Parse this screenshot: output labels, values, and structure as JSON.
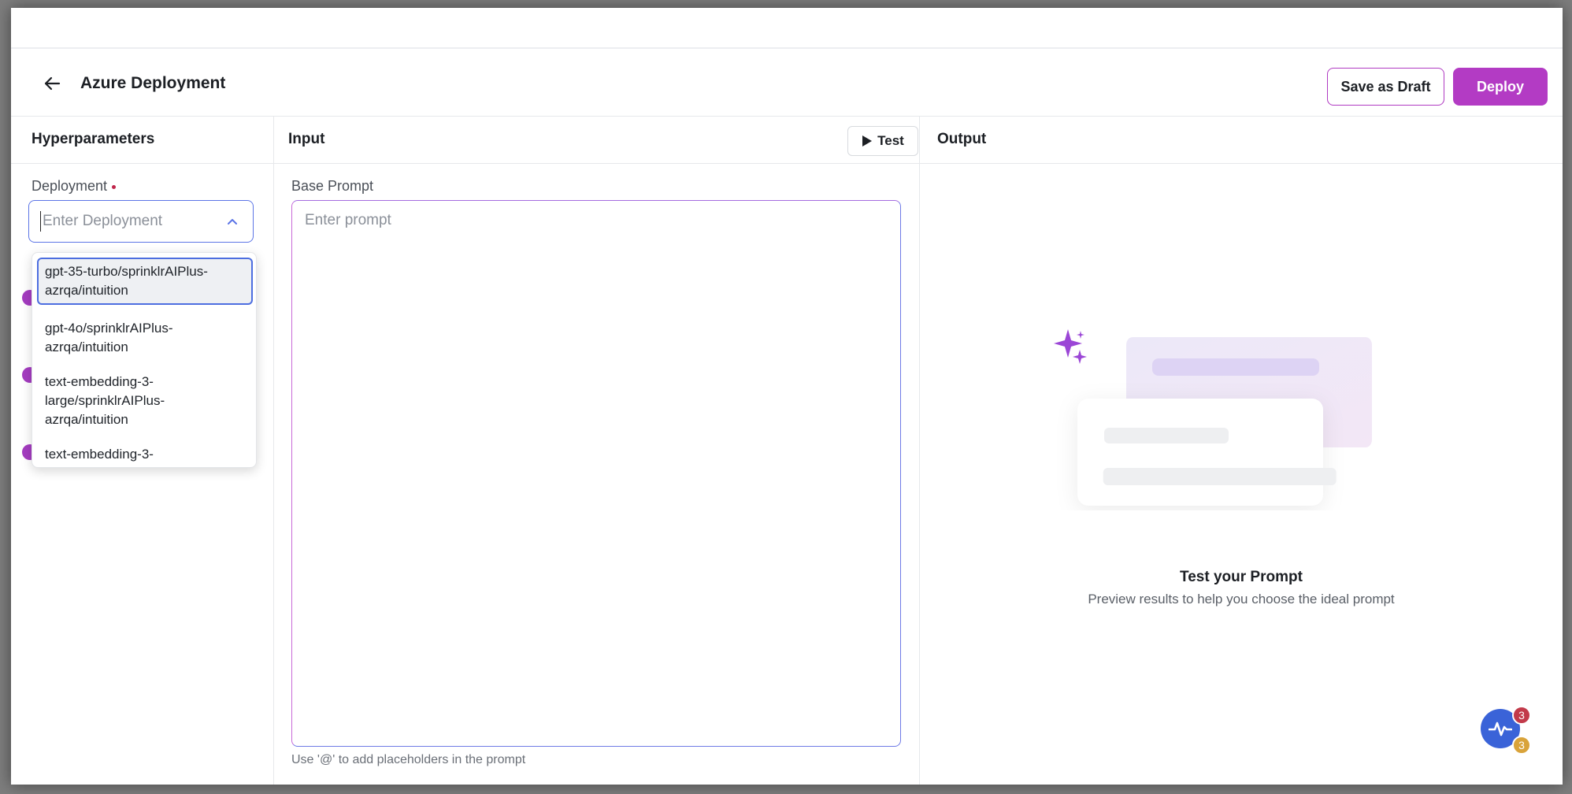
{
  "header": {
    "title": "Azure Deployment",
    "save_draft_label": "Save as Draft",
    "deploy_label": "Deploy"
  },
  "colors": {
    "accent": "#b33bc4",
    "focus": "#5b74e6"
  },
  "hyperparameters": {
    "title": "Hyperparameters",
    "deployment_label": "Deployment",
    "deployment_placeholder": "Enter Deployment",
    "deployment_value": "",
    "dropdown_options": [
      "gpt-35-turbo/sprinklrAIPlus-azrqa/intuition",
      "gpt-4o/sprinklrAIPlus-azrqa/intuition",
      "text-embedding-3-large/sprinklrAIPlus-azrqa/intuition",
      "text-embedding-3-"
    ],
    "dropdown_selected_index": 0
  },
  "input": {
    "title": "Input",
    "test_label": "Test",
    "base_prompt_label": "Base Prompt",
    "prompt_placeholder": "Enter prompt",
    "prompt_value": "",
    "helper_text": "Use '@' to add placeholders in the prompt"
  },
  "output": {
    "title": "Output",
    "empty_title": "Test your Prompt",
    "empty_subtitle": "Preview results to help you choose the ideal prompt"
  },
  "fab": {
    "icon": "activity-icon",
    "badge_top": "3",
    "badge_bottom": "3"
  }
}
